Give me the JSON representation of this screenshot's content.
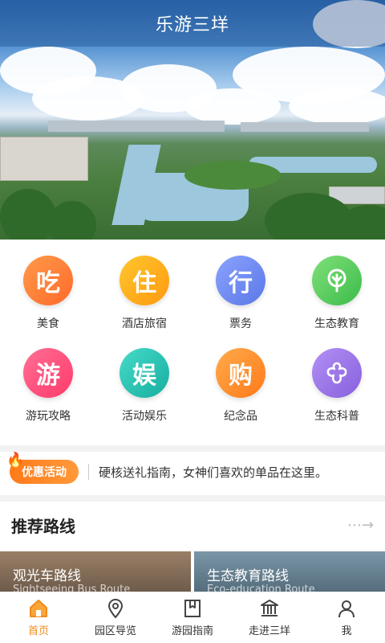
{
  "header": {
    "title": "乐游三垟"
  },
  "grid": {
    "items": [
      {
        "glyph": "吃",
        "label": "美食",
        "color": "#ff7a2e"
      },
      {
        "glyph": "住",
        "label": "酒店旅宿",
        "color": "#ffb11c"
      },
      {
        "glyph": "行",
        "label": "票务",
        "color": "#6f8cf0"
      },
      {
        "glyph": "leaf-icon",
        "label": "生态教育",
        "color": "#5fcc62"
      },
      {
        "glyph": "游",
        "label": "游玩攻略",
        "color": "#ff4f7a"
      },
      {
        "glyph": "娱",
        "label": "活动娱乐",
        "color": "#2dc4b7"
      },
      {
        "glyph": "购",
        "label": "纪念品",
        "color": "#ff8a2a"
      },
      {
        "glyph": "flower-icon",
        "label": "生态科普",
        "color": "#9a72e6"
      }
    ]
  },
  "promo": {
    "badge": "优惠活动",
    "text": "硬核送礼指南，女神们喜欢的单品在这里。"
  },
  "recommend": {
    "title": "推荐路线",
    "routes": [
      {
        "name": "观光车路线",
        "english": "Sightseeing Bus Route"
      },
      {
        "name": "生态教育路线",
        "english": "Eco-education Route"
      }
    ]
  },
  "tabbar": {
    "tabs": [
      {
        "label": "首页",
        "icon": "home-icon",
        "active": true
      },
      {
        "label": "园区导览",
        "icon": "map-pin-icon",
        "active": false
      },
      {
        "label": "游园指南",
        "icon": "bookmark-icon",
        "active": false
      },
      {
        "label": "走进三垟",
        "icon": "museum-icon",
        "active": false
      },
      {
        "label": "我",
        "icon": "user-icon",
        "active": false
      }
    ]
  },
  "colors": {
    "accent": "#f08a1c"
  }
}
